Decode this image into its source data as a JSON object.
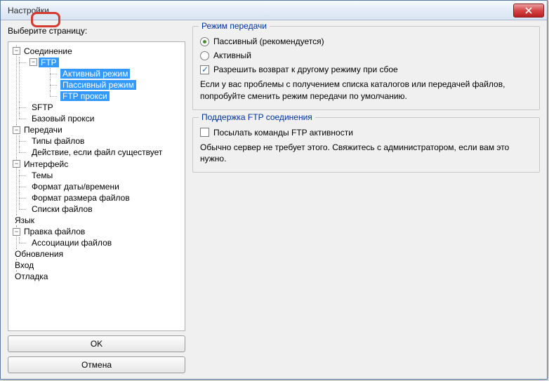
{
  "window": {
    "title": "Настройки"
  },
  "left": {
    "label": "Выберите страницу:",
    "ok": "OK",
    "cancel": "Отмена",
    "tree": {
      "connection": {
        "label": "Соединение",
        "ftp": "FTP",
        "active_mode": "Активный режим",
        "passive_mode": "Пассивный режим",
        "ftp_proxy": "FTP прокси",
        "sftp": "SFTP",
        "base_proxy": "Базовый прокси"
      },
      "transfers": {
        "label": "Передачи",
        "file_types": "Типы файлов",
        "file_exists": "Действие, если файл существует"
      },
      "interface": {
        "label": "Интерфейс",
        "themes": "Темы",
        "date_format": "Формат даты/времени",
        "size_format": "Формат размера файлов",
        "file_lists": "Списки файлов"
      },
      "language": "Язык",
      "file_edit": {
        "label": "Правка файлов",
        "assoc": "Ассоциации файлов"
      },
      "updates": "Обновления",
      "login": "Вход",
      "debug": "Отладка"
    }
  },
  "right": {
    "group1": {
      "title": "Режим передачи",
      "passive": "Пассивный (рекомендуется)",
      "active": "Активный",
      "fallback": "Разрешить возврат к другому режиму при сбое",
      "hint": "Если у вас проблемы с получением списка каталогов или передачей файлов, попробуйте сменить режим передачи по умолчанию."
    },
    "group2": {
      "title": "Поддержка FTP соединения",
      "keepalive": "Посылать команды FTP активности",
      "hint": "Обычно сервер не требует этого. Свяжитесь с администратором, если вам это нужно."
    }
  }
}
